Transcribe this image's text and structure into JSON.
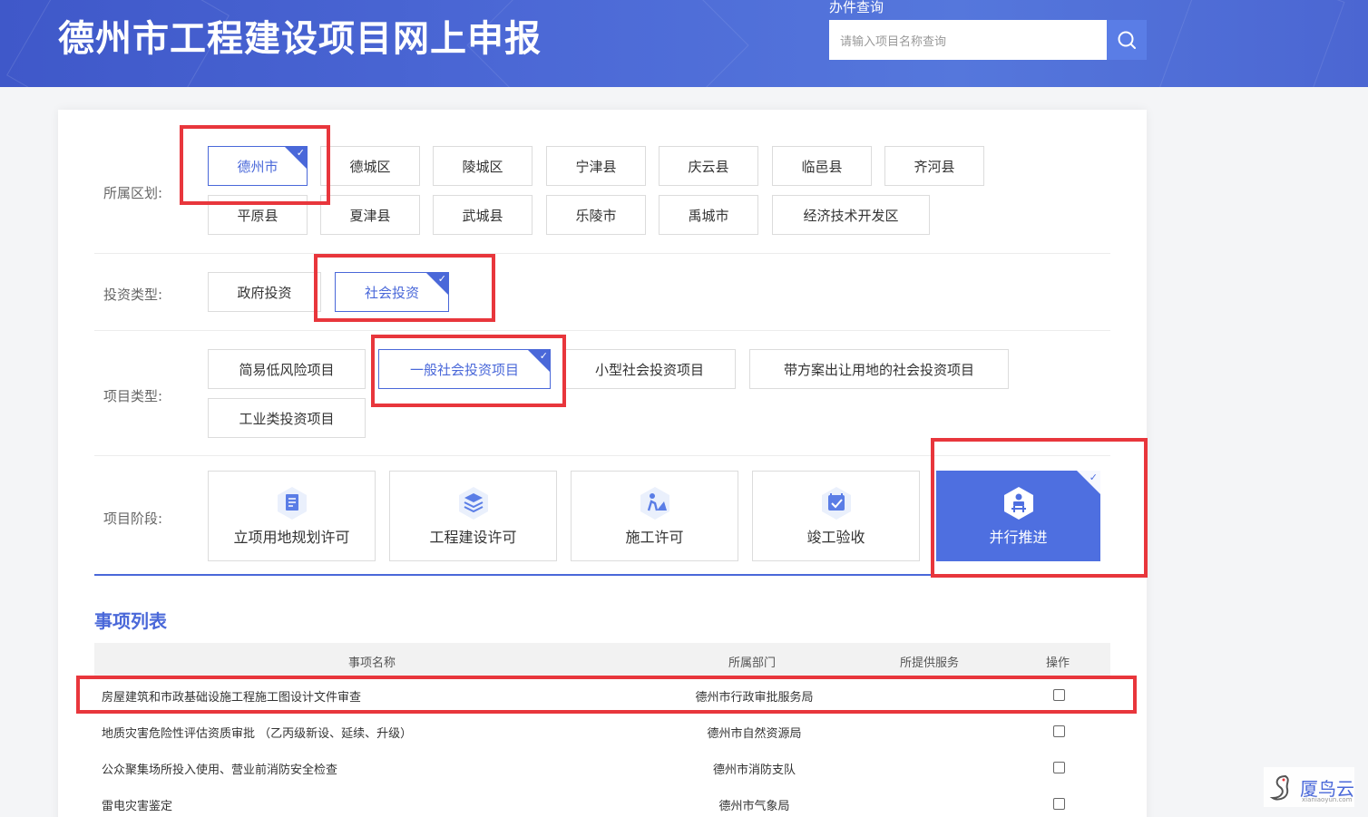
{
  "header": {
    "title": "德州市工程建设项目网上申报",
    "query_label": "办件查询",
    "search_placeholder": "请输入项目名称查询"
  },
  "filters": {
    "region": {
      "label": "所属区划:",
      "options": [
        "德州市",
        "德城区",
        "陵城区",
        "宁津县",
        "庆云县",
        "临邑县",
        "齐河县",
        "平原县",
        "夏津县",
        "武城县",
        "乐陵市",
        "禹城市",
        "经济技术开发区"
      ],
      "selected": "德州市"
    },
    "investment_type": {
      "label": "投资类型:",
      "options": [
        "政府投资",
        "社会投资"
      ],
      "selected": "社会投资"
    },
    "project_type": {
      "label": "项目类型:",
      "options": [
        "简易低风险项目",
        "一般社会投资项目",
        "小型社会投资项目",
        "带方案出让用地的社会投资项目",
        "工业类投资项目"
      ],
      "selected": "一般社会投资项目"
    },
    "stage": {
      "label": "项目阶段:",
      "options": [
        {
          "label": "立项用地规划许可",
          "icon": "document-icon"
        },
        {
          "label": "工程建设许可",
          "icon": "layers-icon"
        },
        {
          "label": "施工许可",
          "icon": "construction-worker-icon"
        },
        {
          "label": "竣工验收",
          "icon": "calendar-check-icon"
        },
        {
          "label": "并行推进",
          "icon": "people-icon"
        }
      ],
      "selected": "并行推进"
    }
  },
  "matters": {
    "title": "事项列表",
    "columns": [
      "事项名称",
      "所属部门",
      "所提供服务",
      "操作"
    ],
    "rows": [
      {
        "name": "房屋建筑和市政基础设施工程施工图设计文件审查",
        "dept": "德州市行政审批服务局",
        "service": "",
        "checked": false
      },
      {
        "name": "地质灾害危险性评估资质审批 （乙丙级新设、延续、升级）",
        "dept": "德州市自然资源局",
        "service": "",
        "checked": false
      },
      {
        "name": "公众聚集场所投入使用、营业前消防安全检查",
        "dept": "德州市消防支队",
        "service": "",
        "checked": false
      },
      {
        "name": "雷电灾害鉴定",
        "dept": "德州市气象局",
        "service": "",
        "checked": false
      }
    ]
  },
  "watermark": {
    "text": "厦鸟云",
    "sub": "xianiaoyun.com"
  },
  "colors": {
    "accent": "#4a68d9",
    "header": "#4c69d6",
    "annotation": "#e8363c"
  }
}
